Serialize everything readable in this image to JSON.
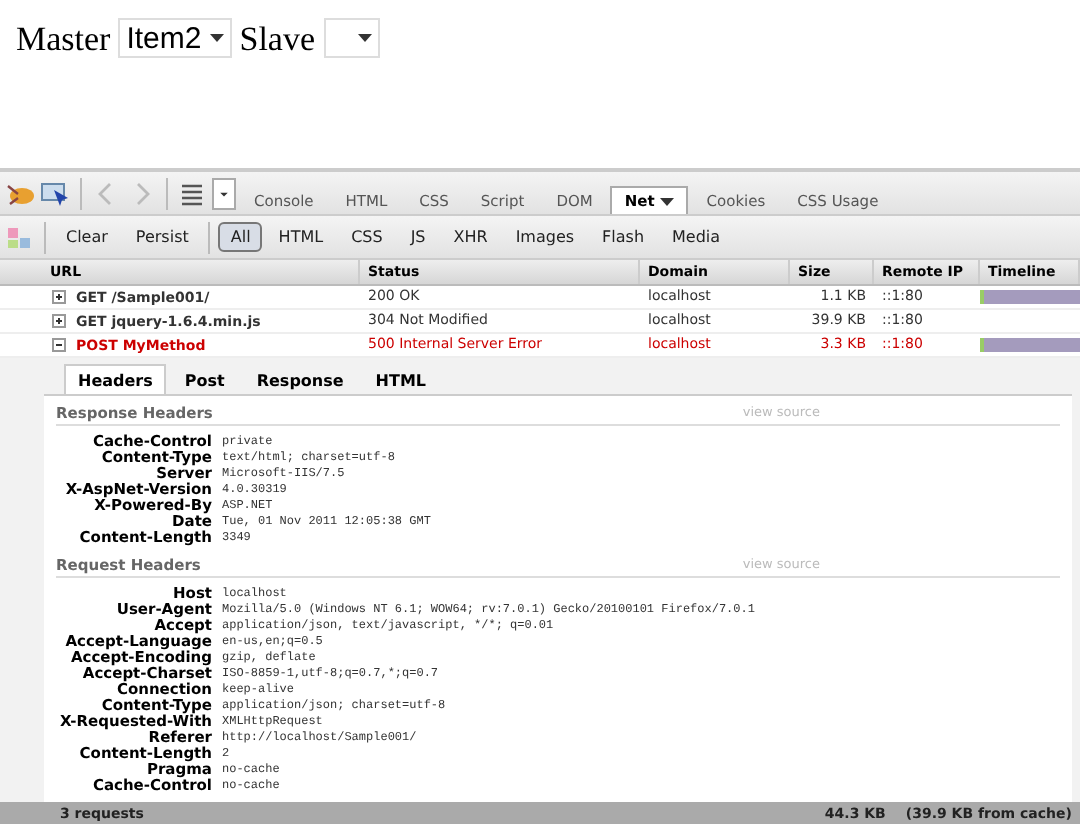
{
  "page": {
    "master_label": "Master",
    "master_value": "Item2",
    "slave_label": "Slave"
  },
  "panel_tabs": [
    {
      "label": "Console",
      "selected": false
    },
    {
      "label": "HTML",
      "selected": false
    },
    {
      "label": "CSS",
      "selected": false
    },
    {
      "label": "Script",
      "selected": false
    },
    {
      "label": "DOM",
      "selected": false
    },
    {
      "label": "Net",
      "selected": true
    },
    {
      "label": "Cookies",
      "selected": false
    },
    {
      "label": "CSS Usage",
      "selected": false
    }
  ],
  "net_toolbar": {
    "actions": [
      "Clear",
      "Persist"
    ],
    "filters": [
      {
        "label": "All",
        "selected": true
      },
      {
        "label": "HTML",
        "selected": false
      },
      {
        "label": "CSS",
        "selected": false
      },
      {
        "label": "JS",
        "selected": false
      },
      {
        "label": "XHR",
        "selected": false
      },
      {
        "label": "Images",
        "selected": false
      },
      {
        "label": "Flash",
        "selected": false
      },
      {
        "label": "Media",
        "selected": false
      }
    ]
  },
  "table": {
    "columns": [
      "URL",
      "Status",
      "Domain",
      "Size",
      "Remote IP",
      "Timeline"
    ],
    "rows": [
      {
        "url": "GET /Sample001/",
        "status": "200 OK",
        "domain": "localhost",
        "size": "1.1 KB",
        "remote_ip": "::1:80",
        "expanded": false,
        "error": false,
        "timeline": true
      },
      {
        "url": "GET jquery-1.6.4.min.js",
        "status": "304 Not Modified",
        "domain": "localhost",
        "size": "39.9 KB",
        "remote_ip": "::1:80",
        "expanded": false,
        "error": false,
        "timeline": false
      },
      {
        "url": "POST MyMethod",
        "status": "500 Internal Server Error",
        "domain": "localhost",
        "size": "3.3 KB",
        "remote_ip": "::1:80",
        "expanded": true,
        "error": true,
        "timeline": true
      }
    ]
  },
  "detail": {
    "tabs": [
      {
        "label": "Headers",
        "selected": true
      },
      {
        "label": "Post",
        "selected": false
      },
      {
        "label": "Response",
        "selected": false
      },
      {
        "label": "HTML",
        "selected": false
      }
    ],
    "sections": [
      {
        "title": "Response Headers",
        "link": "view source",
        "headers": [
          {
            "name": "Cache-Control",
            "value": "private"
          },
          {
            "name": "Content-Type",
            "value": "text/html; charset=utf-8"
          },
          {
            "name": "Server",
            "value": "Microsoft-IIS/7.5"
          },
          {
            "name": "X-AspNet-Version",
            "value": "4.0.30319"
          },
          {
            "name": "X-Powered-By",
            "value": "ASP.NET"
          },
          {
            "name": "Date",
            "value": "Tue, 01 Nov 2011 12:05:38 GMT"
          },
          {
            "name": "Content-Length",
            "value": "3349"
          }
        ]
      },
      {
        "title": "Request Headers",
        "link": "view source",
        "headers": [
          {
            "name": "Host",
            "value": "localhost"
          },
          {
            "name": "User-Agent",
            "value": "Mozilla/5.0 (Windows NT 6.1; WOW64; rv:7.0.1) Gecko/20100101 Firefox/7.0.1"
          },
          {
            "name": "Accept",
            "value": "application/json, text/javascript, */*; q=0.01"
          },
          {
            "name": "Accept-Language",
            "value": "en-us,en;q=0.5"
          },
          {
            "name": "Accept-Encoding",
            "value": "gzip, deflate"
          },
          {
            "name": "Accept-Charset",
            "value": "ISO-8859-1,utf-8;q=0.7,*;q=0.7"
          },
          {
            "name": "Connection",
            "value": "keep-alive"
          },
          {
            "name": "Content-Type",
            "value": "application/json; charset=utf-8"
          },
          {
            "name": "X-Requested-With",
            "value": "XMLHttpRequest"
          },
          {
            "name": "Referer",
            "value": "http://localhost/Sample001/"
          },
          {
            "name": "Content-Length",
            "value": "2"
          },
          {
            "name": "Pragma",
            "value": "no-cache"
          },
          {
            "name": "Cache-Control",
            "value": "no-cache"
          }
        ]
      }
    ]
  },
  "status_bar": {
    "requests": "3 requests",
    "total": "44.3 KB",
    "cache": "(39.9 KB from cache)"
  }
}
